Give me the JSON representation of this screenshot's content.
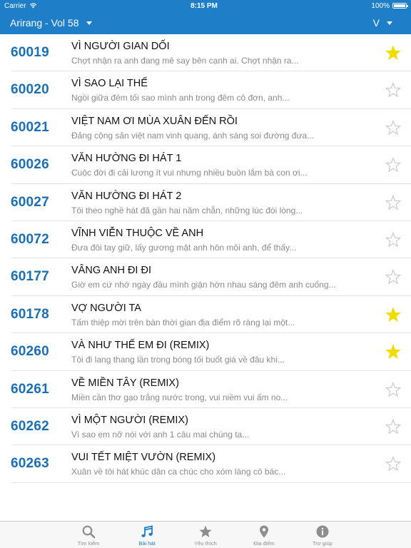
{
  "status_bar": {
    "carrier": "Carrier",
    "time": "8:15 PM",
    "battery": "100%"
  },
  "nav": {
    "title": "Arirang - Vol 58",
    "filter": "V"
  },
  "colors": {
    "accent": "#1e7ec8",
    "code": "#1b6fb5",
    "star_on": "#f0dd00",
    "star_off": "#c8c8c8"
  },
  "songs": [
    {
      "code": "60019",
      "title": "VÌ NGƯỜI GIAN DỐI",
      "lyric": "Chợt nhận ra anh đang mê say bên cạnh ai. Chợt nhận ra...",
      "favorite": true
    },
    {
      "code": "60020",
      "title": "VÌ SAO LẠI THẾ",
      "lyric": "Ngồi giữa đêm tối sao mình anh trong đêm cô đơn, anh...",
      "favorite": false
    },
    {
      "code": "60021",
      "title": "VIỆT NAM ƠI MÙA XUÂN ĐẾN RỒI",
      "lyric": "Đảng cộng sản việt nam vinh quang, ánh sáng soi đường đưa...",
      "favorite": false
    },
    {
      "code": "60026",
      "title": "VĂN HƯỜNG ĐI HÁT 1",
      "lyric": "Cuộc đời đi cải lương ít vui nhưng nhiều buồn lắm bà con ơi...",
      "favorite": false
    },
    {
      "code": "60027",
      "title": "VĂN HƯỜNG ĐI HÁT 2",
      "lyric": "Tôi theo nghề hát đã gần hai năm chẵn, những lúc đói lòng...",
      "favorite": false
    },
    {
      "code": "60072",
      "title": "VĨNH VIỄN THUỘC VỀ ANH",
      "lyric": "Đưa đôi tay giữ, lấy gương mặt anh hôn môi anh, để thấy...",
      "favorite": false
    },
    {
      "code": "60177",
      "title": "VÂNG ANH ĐI ĐI",
      "lyric": "Giờ em cứ nhớ ngày đầu mình giận hờn nhau sáng đêm anh cuống...",
      "favorite": false
    },
    {
      "code": "60178",
      "title": "VỢ NGƯỜI TA",
      "lyric": "Tấm thiệp mời trên bàn thời gian địa điểm rõ ràng lại một...",
      "favorite": true
    },
    {
      "code": "60260",
      "title": "VÀ NHƯ THẾ EM ĐI (REMIX)",
      "lyric": "Tôi đi lang thang lần trong bóng tối buốt giá về đâu khi...",
      "favorite": true
    },
    {
      "code": "60261",
      "title": "VỀ MIỀN TÂY (REMIX)",
      "lyric": "Miền cần thơ gạo trắng nước trong, vui niềm vui ấm no...",
      "favorite": false
    },
    {
      "code": "60262",
      "title": "VÌ MỘT NGƯỜI (REMIX)",
      "lyric": "Vì sao em nỡ nói với anh 1 câu mai chúng ta...",
      "favorite": false
    },
    {
      "code": "60263",
      "title": "VUI TẾT MIỆT VƯỜN (REMIX)",
      "lyric": "Xuân về tôi hát khúc dân ca chúc cho xóm làng cô bác...",
      "favorite": false
    }
  ],
  "tabs": [
    {
      "label": "Tìm kiếm",
      "icon": "search-icon",
      "active": false
    },
    {
      "label": "Bài hát",
      "icon": "music-note-icon",
      "active": true
    },
    {
      "label": "Yêu thích",
      "icon": "star-icon",
      "active": false
    },
    {
      "label": "Địa điểm",
      "icon": "map-pin-icon",
      "active": false
    },
    {
      "label": "Trợ giúp",
      "icon": "info-icon",
      "active": false
    }
  ]
}
